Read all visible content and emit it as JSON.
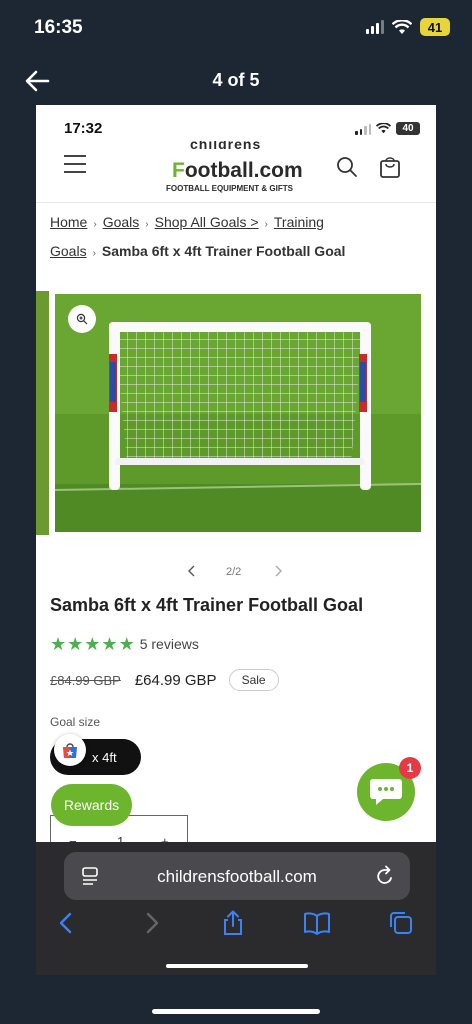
{
  "outer": {
    "time": "16:35",
    "battery": "41",
    "counter": "4 of 5"
  },
  "inner": {
    "time": "17:32",
    "battery": "40",
    "logo": {
      "top_text": "childrens",
      "k": "F",
      "main": "ootball.com",
      "sub": "FOOTBALL EQUIPMENT & GIFTS"
    },
    "breadcrumb": [
      "Home",
      "Goals",
      "Shop All Goals >",
      "Training Goals",
      "Samba 6ft x 4ft Trainer Football Goal"
    ],
    "gallery": {
      "counter": "2/2"
    },
    "product": {
      "title": "Samba 6ft x 4ft Trainer Football Goal",
      "rating": 5,
      "reviews": "5 reviews",
      "old_price": "£84.99 GBP",
      "price": "£64.99 GBP",
      "sale_badge": "Sale",
      "size_label": "Goal size",
      "size_value": "x 4ft",
      "qty_minus": "−",
      "qty_value": "1",
      "qty_plus": "+"
    },
    "rewards_label": "Rewards",
    "chat_badge": "1",
    "safari": {
      "url": "childrensfootball.com"
    },
    "colors": {
      "brand_green": "#6cb52d",
      "star_green": "#4caf50",
      "safari_blue": "#3b82f6"
    }
  }
}
